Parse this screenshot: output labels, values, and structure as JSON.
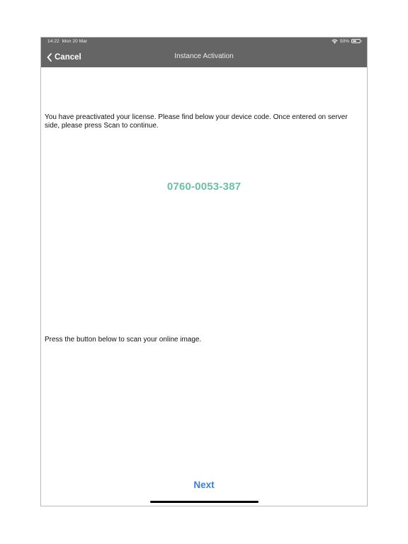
{
  "status_bar": {
    "time": "14:22",
    "date": "Mon 20 Mar",
    "battery_text": "50%",
    "battery_level": 0.5,
    "icons": [
      "wifi-icon",
      "battery-icon"
    ]
  },
  "nav": {
    "back_icon": "chevron-left-icon",
    "cancel_label": "Cancel",
    "title": "Instance Activation"
  },
  "content": {
    "intro_text": "You have preactivated your license. Please find below your device code. Once entered on server side, please press Scan to continue.",
    "device_code": "0760-0053-387",
    "scan_text": "Press the button below to scan your online image.",
    "next_label": "Next"
  },
  "colors": {
    "bar_background": "#656565",
    "device_code": "#6dbfa2",
    "next_button": "#3b7fd6"
  }
}
